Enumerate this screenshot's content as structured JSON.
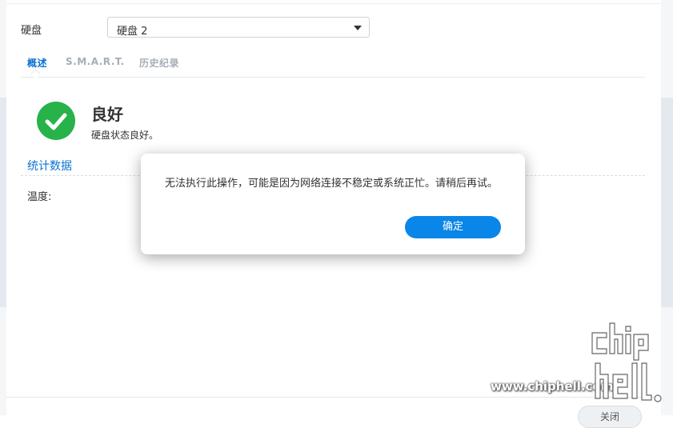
{
  "window": {
    "disk_label": "硬盘",
    "disk_select": {
      "value": "硬盘 2"
    },
    "tabs": [
      {
        "label": "概述",
        "active": true
      },
      {
        "label": "S.M.A.R.T.",
        "active": false
      },
      {
        "label": "历史纪录",
        "active": false
      }
    ],
    "status": {
      "title": "良好",
      "description": "硬盘状态良好。",
      "icon": "check-circle-icon"
    },
    "stats": {
      "section_title": "统计数据",
      "temperature_label": "温度:"
    },
    "footer": {
      "close_label": "关闭"
    }
  },
  "dialog": {
    "message": "无法执行此操作，可能是因为网络连接不稳定或系统正忙。请稍后再试。",
    "ok_label": "确定"
  },
  "watermark": {
    "text": "www.chiphell.com",
    "logo_text": "chiphell"
  },
  "colors": {
    "accent": "#0a72cf",
    "button": "#0a86e8",
    "success": "#27b24a"
  }
}
